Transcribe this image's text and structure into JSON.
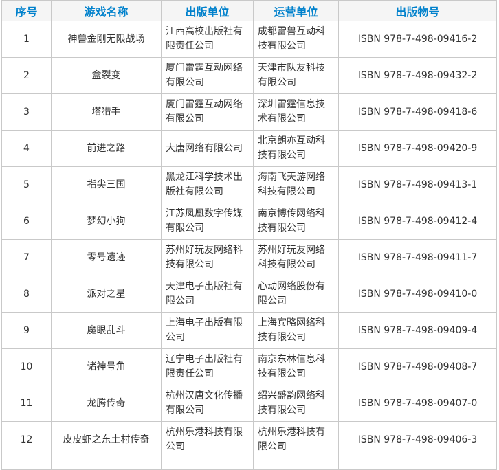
{
  "headers": {
    "index": "序号",
    "name": "游戏名称",
    "publisher": "出版单位",
    "operator": "运营单位",
    "isbn": "出版物号"
  },
  "rows": [
    {
      "index": "1",
      "name": "神兽金刚无限战场",
      "publisher": "江西高校出版社有限责任公司",
      "operator": "成都雷兽互动科技有限公司",
      "isbn": "ISBN 978-7-498-09416-2"
    },
    {
      "index": "2",
      "name": "盒裂变",
      "publisher": "厦门雷霆互动网络有限公司",
      "operator": "天津市队友科技有限公司",
      "isbn": "ISBN 978-7-498-09432-2"
    },
    {
      "index": "3",
      "name": "塔猎手",
      "publisher": "厦门雷霆互动网络有限公司",
      "operator": "深圳雷霆信息技术有限公司",
      "isbn": "ISBN 978-7-498-09418-6"
    },
    {
      "index": "4",
      "name": "前进之路",
      "publisher": "大唐网络有限公司",
      "operator": "北京朗亦互动科技有限公司",
      "isbn": "ISBN 978-7-498-09420-9"
    },
    {
      "index": "5",
      "name": "指尖三国",
      "publisher": "黑龙江科学技术出版社有限公司",
      "operator": "海南飞天游网络科技有限公司",
      "isbn": "ISBN 978-7-498-09413-1"
    },
    {
      "index": "6",
      "name": "梦幻小狗",
      "publisher": "江苏凤凰数字传媒有限公司",
      "operator": "南京博传网络科技有限公司",
      "isbn": "ISBN 978-7-498-09412-4"
    },
    {
      "index": "7",
      "name": "零号遗迹",
      "publisher": "苏州好玩友网络科技有限公司",
      "operator": "苏州好玩友网络科技有限公司",
      "isbn": "ISBN 978-7-498-09411-7"
    },
    {
      "index": "8",
      "name": "派对之星",
      "publisher": "天津电子出版社有限公司",
      "operator": "心动网络股份有限公司",
      "isbn": "ISBN 978-7-498-09410-0"
    },
    {
      "index": "9",
      "name": "魔眼乱斗",
      "publisher": "上海电子出版有限公司",
      "operator": "上海宾略网络科技有限公司",
      "isbn": "ISBN 978-7-498-09409-4"
    },
    {
      "index": "10",
      "name": "诸神号角",
      "publisher": "辽宁电子出版社有限责任公司",
      "operator": "南京东林信息科技有限公司",
      "isbn": "ISBN 978-7-498-09408-7"
    },
    {
      "index": "11",
      "name": "龙腾传奇",
      "publisher": "杭州汉唐文化传播有限公司",
      "operator": "绍兴盛韵网络科技有限公司",
      "isbn": "ISBN 978-7-498-09407-0"
    },
    {
      "index": "12",
      "name": "皮皮虾之东土村传奇",
      "publisher": "杭州乐港科技有限公司",
      "operator": "杭州乐港科技有限公司",
      "isbn": "ISBN 978-7-498-09406-3"
    }
  ]
}
